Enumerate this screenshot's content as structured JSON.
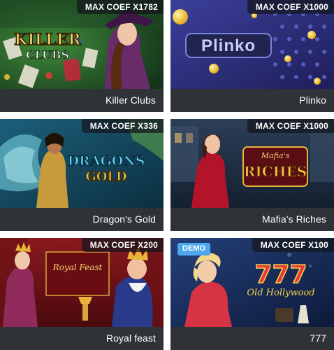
{
  "games": [
    {
      "title": "Killer Clubs",
      "max_coef": "MAX COEF X1782"
    },
    {
      "title": "Plinko",
      "max_coef": "MAX COEF X1000"
    },
    {
      "title": "Dragon's Gold",
      "max_coef": "MAX COEF X336"
    },
    {
      "title": "Mafia's Riches",
      "max_coef": "MAX COEF X1000"
    },
    {
      "title": "Royal feast",
      "max_coef": "MAX COEF X200"
    },
    {
      "title": "777",
      "max_coef": "MAX COEF X100",
      "badge": "DEMO"
    }
  ],
  "logos": {
    "killer": "KILLER",
    "clubs": "CLUBS",
    "plinko": "Plinko",
    "dragons": "DRAGONS",
    "gold": "GOLD",
    "mafias": "Mafia's",
    "riches": "RICHES",
    "royal_feast": "Royal Feast",
    "sevens": "777",
    "old_hollywood": "Old Hollywood"
  },
  "colors": {
    "title_bar": "#2f3237",
    "demo_badge": "#4ea8ef",
    "coef_badge": "#14161c"
  }
}
